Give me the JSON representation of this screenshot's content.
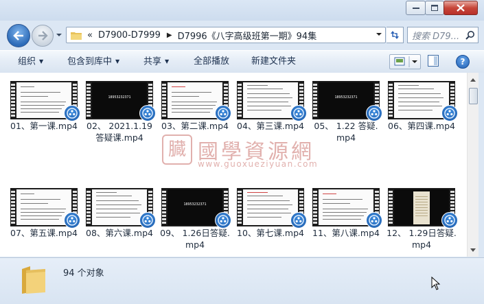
{
  "window": {
    "minimize_label": "─",
    "maximize_label": "□",
    "close_label": "✕"
  },
  "address": {
    "overflow": "«",
    "crumbs": [
      "D7900-D7999",
      "D7996《八字高级班第一期》94集"
    ]
  },
  "search": {
    "placeholder": "搜索 D79..."
  },
  "toolbar": {
    "organize": "组织",
    "include": "包含到库中",
    "share": "共享",
    "playall": "全部播放",
    "newfolder": "新建文件夹",
    "help": "?"
  },
  "files": [
    {
      "name": "01、第一课.mp4",
      "thumb": "white"
    },
    {
      "name": "02、 2021.1.19答疑课.mp4",
      "thumb": "black",
      "phone": "18953232371"
    },
    {
      "name": "03、第二课.mp4",
      "thumb": "white-red"
    },
    {
      "name": "04、第三课.mp4",
      "thumb": "white"
    },
    {
      "name": "05、 1.22 答疑.mp4",
      "thumb": "black",
      "phone": "18953232371"
    },
    {
      "name": "06、第四课.mp4",
      "thumb": "white"
    },
    {
      "name": "07、第五课.mp4",
      "thumb": "white"
    },
    {
      "name": "08、第六课.mp4",
      "thumb": "white"
    },
    {
      "name": "09、 1.26日答疑.mp4",
      "thumb": "black",
      "phone": "18953232371"
    },
    {
      "name": "10、第七课.mp4",
      "thumb": "white-red"
    },
    {
      "name": "11、第八课.mp4",
      "thumb": "white-red"
    },
    {
      "name": "12、 1.29日答疑.mp4",
      "thumb": "black-doc"
    }
  ],
  "status": {
    "count": "94 个对象"
  },
  "watermark": {
    "title": "國學資源網",
    "url": "www.guoxueziyuan.com",
    "seal": "臓"
  }
}
